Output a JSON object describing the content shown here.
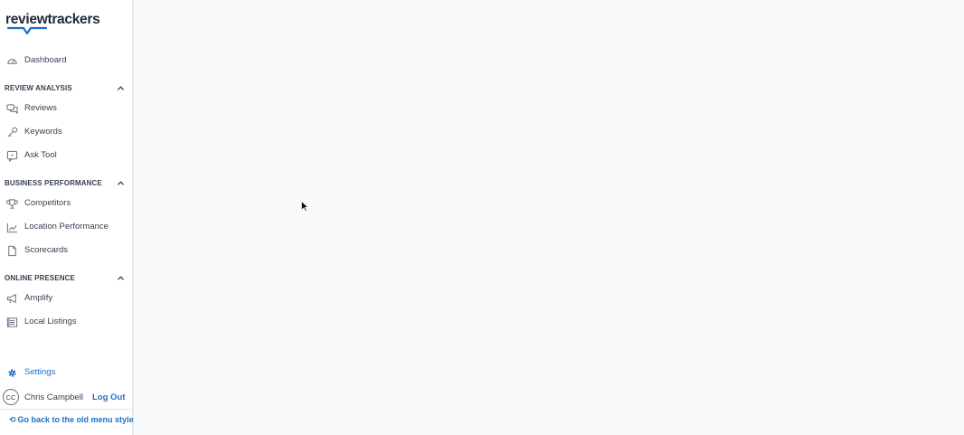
{
  "app": {
    "logo_text": "reviewtrackers"
  },
  "sidebar": {
    "dashboard": {
      "label": "Dashboard",
      "icon": "dashboard-gauge-icon"
    },
    "sections": [
      {
        "title": "REVIEW ANALYSIS",
        "expanded": true,
        "items": [
          {
            "label": "Reviews",
            "icon": "chat-bubbles-icon"
          },
          {
            "label": "Keywords",
            "icon": "key-icon"
          },
          {
            "label": "Ask Tool",
            "icon": "ask-chat-icon"
          }
        ]
      },
      {
        "title": "BUSINESS PERFORMANCE",
        "expanded": true,
        "items": [
          {
            "label": "Competitors",
            "icon": "trophy-icon"
          },
          {
            "label": "Location Performance",
            "icon": "line-chart-icon"
          },
          {
            "label": "Scorecards",
            "icon": "document-icon"
          }
        ]
      },
      {
        "title": "ONLINE PRESENCE",
        "expanded": true,
        "items": [
          {
            "label": "Amplify",
            "icon": "megaphone-icon"
          },
          {
            "label": "Local Listings",
            "icon": "listings-icon"
          }
        ]
      }
    ],
    "settings": {
      "label": "Settings",
      "icon": "gear-icon"
    },
    "user": {
      "initials": "CC",
      "name": "Chris Campbell",
      "logout_label": "Log Out"
    },
    "old_menu_label": "Go back to the old menu style"
  },
  "colors": {
    "accent": "#1d6fc7",
    "text": "#374151",
    "sidebar_bg": "#ffffff",
    "main_bg": "#f8fafc"
  }
}
